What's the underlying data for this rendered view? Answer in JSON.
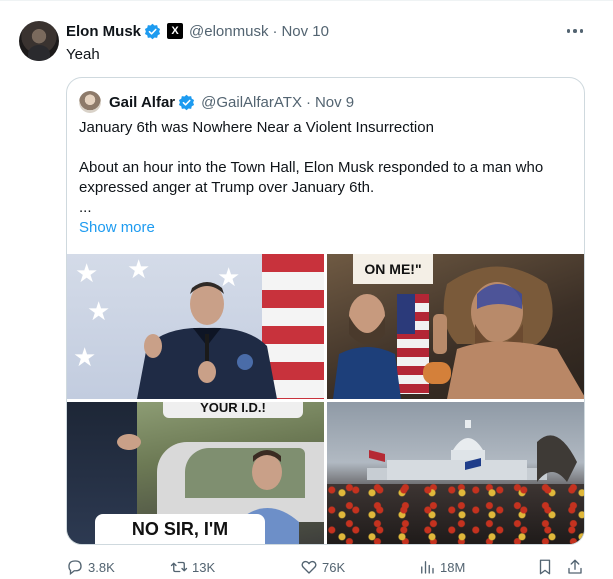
{
  "tweet": {
    "author_name": "Elon Musk",
    "x_badge": "X",
    "handle": "@elonmusk",
    "separator": "·",
    "time": "Nov 10",
    "text": "Yeah"
  },
  "quote": {
    "author_name": "Gail Alfar",
    "handle": "@GailAlfarATX",
    "separator": "·",
    "time": "Nov 9",
    "line1": "January 6th was Nowhere Near a Violent Insurrection",
    "line2": "About an hour into the Town Hall, Elon Musk responded to a man who expressed anger at Trump over January 6th.",
    "ellipsis": "...",
    "show_more": "Show more",
    "images": {
      "img2_sign": "ON ME!\"",
      "img3_sign_top": "YOUR I.D.!",
      "img3_sign_bottom": "NO SIR, I'M"
    }
  },
  "actions": {
    "replies": "3.8K",
    "reposts": "13K",
    "likes": "76K",
    "views": "18M"
  },
  "colors": {
    "accent": "#1d9bf0",
    "secondary_text": "#536471",
    "border": "#cfd9de"
  }
}
